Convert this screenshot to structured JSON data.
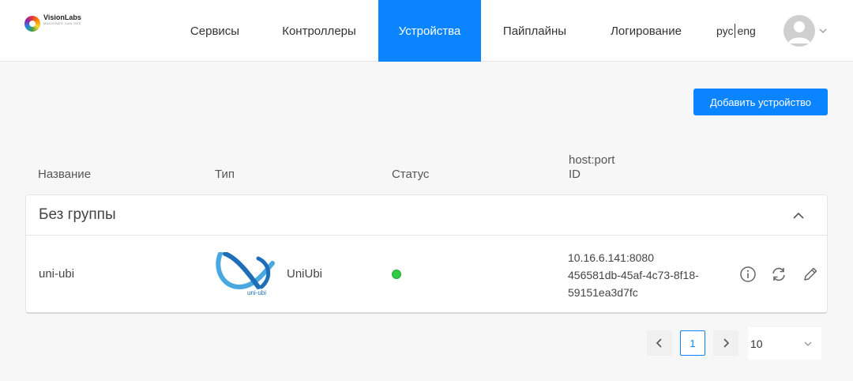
{
  "brand": {
    "name": "VisionLabs",
    "tagline": "MACHINES CAN SEE"
  },
  "nav": {
    "services": "Сервисы",
    "controllers": "Контроллеры",
    "devices": "Устройства",
    "pipelines": "Пайплайны",
    "logging": "Логирование",
    "active": "devices"
  },
  "lang": {
    "ru": "рус",
    "en": "eng"
  },
  "user": {
    "avatar_icon": "user-avatar-icon",
    "menu_icon": "chevron-down-icon"
  },
  "toolbar": {
    "add_label": "Добавить устройство"
  },
  "table": {
    "headers": {
      "name": "Название",
      "type": "Тип",
      "status": "Статус",
      "host_line1": "host:port",
      "host_line2": "ID"
    }
  },
  "group": {
    "title": "Без группы",
    "expanded": true,
    "rows": [
      {
        "name": "uni-ubi",
        "type": "UniUbi",
        "type_logo_text": "uni-ubi",
        "status_color": "#2ecc40",
        "host_port": "10.16.6.141:8080",
        "id_line1": "456581db-45af-4c73-8f18-",
        "id_line2": "59151ea3d7fc"
      }
    ]
  },
  "pagination": {
    "current_page": "1",
    "page_size": "10"
  },
  "colors": {
    "accent": "#0a84ff",
    "status_ok": "#2ecc40"
  }
}
